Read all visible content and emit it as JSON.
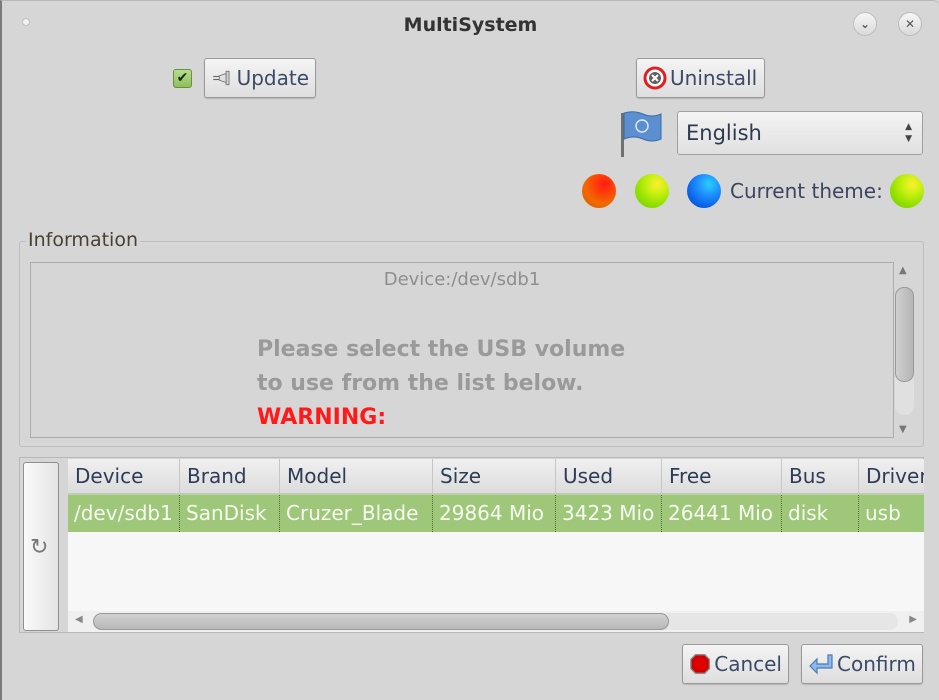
{
  "window": {
    "title": "MultiSystem",
    "minimize_glyph": "⌄",
    "close_glyph": "✕"
  },
  "toolbar": {
    "update_checked": true,
    "check_glyph": "✔",
    "update_label": "Update",
    "update_icon": "plug-icon",
    "uninstall_label": "Uninstall",
    "uninstall_icon": "remove-circle-icon"
  },
  "language": {
    "flag_icon": "un-flag-icon",
    "selected": "English",
    "arrows": "▲\n▼"
  },
  "themes": {
    "options": [
      {
        "name": "red",
        "color": "#f06a00"
      },
      {
        "name": "green",
        "color": "#8fe000"
      },
      {
        "name": "blue",
        "color": "#0a60e8"
      }
    ],
    "current_label": "Current theme:",
    "current": {
      "name": "green",
      "color": "#8fe000"
    }
  },
  "information": {
    "group_title": "Information",
    "device_line": "Device:/dev/sdb1",
    "message_line1": "Please select the USB volume",
    "message_line2": "to use from the list below.",
    "warning": "WARNING:",
    "warning_color": "#ff1a1a"
  },
  "device_table": {
    "refresh_glyph": "↻",
    "columns": [
      "Device",
      "Brand",
      "Model",
      "Size",
      "Used",
      "Free",
      "Bus",
      "Driver"
    ],
    "rows": [
      [
        "/dev/sdb1",
        "SanDisk",
        "Cruzer_Blade",
        "29864 Mio",
        "3423 Mio",
        "26441 Mio",
        "disk",
        "usb"
      ]
    ],
    "selected_row_color": "#9ec77a"
  },
  "footer": {
    "cancel_label": "Cancel",
    "confirm_label": "Confirm"
  }
}
